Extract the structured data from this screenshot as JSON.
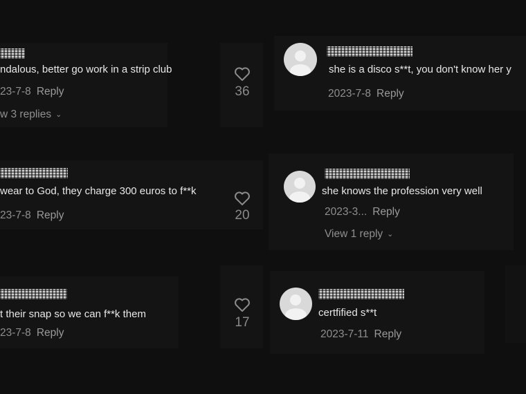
{
  "comments_left": [
    {
      "text": "ndalous, better go work in a strip club",
      "date": "23-7-8",
      "reply_label": "Reply",
      "view_replies": "w 3 replies",
      "likes": "36"
    },
    {
      "text": "wear to God, they charge 300 euros to f**k",
      "date": "23-7-8",
      "reply_label": "Reply",
      "likes": "20"
    },
    {
      "text": "t their snap so we can f**k them",
      "date": "23-7-8",
      "reply_label": "Reply",
      "likes": "17"
    }
  ],
  "comments_right": [
    {
      "text": "she is a disco s**t, you don't know her y",
      "date": "2023-7-8",
      "reply_label": "Reply"
    },
    {
      "text": "she knows the profession very well",
      "date": "2023-3...",
      "reply_label": "Reply",
      "view_replies": "View 1 reply"
    },
    {
      "text": "certfified s**t",
      "date": "2023-7-11",
      "reply_label": "Reply"
    }
  ],
  "icons": {
    "like": "heart-outline-icon",
    "expand": "chevron-down-icon",
    "avatar": "default-avatar-icon"
  },
  "colors": {
    "background": "#0f0f0f",
    "text": "#e8e8e8",
    "meta": "#8f8f8f",
    "avatar": "#d9d9d9"
  }
}
